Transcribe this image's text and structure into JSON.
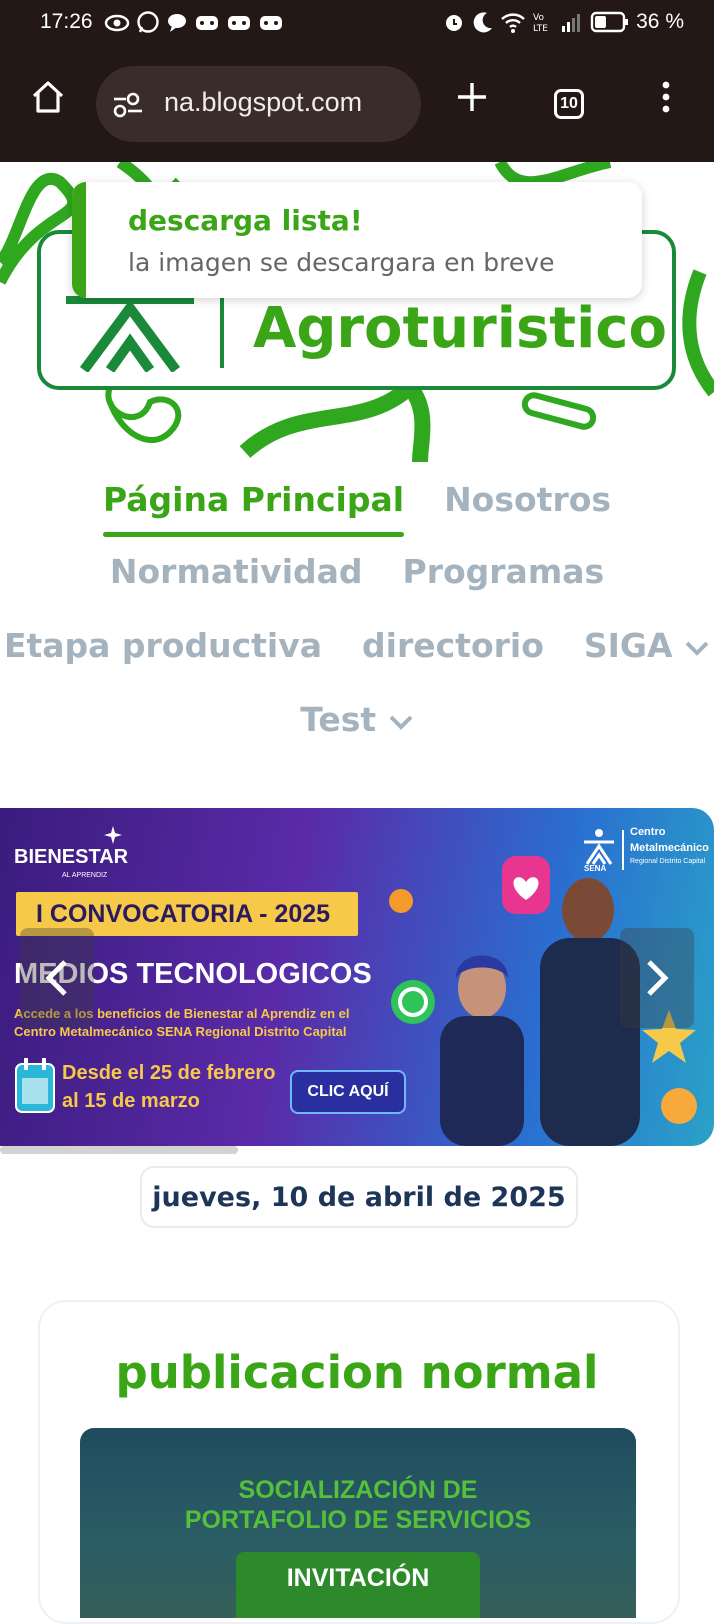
{
  "status_bar": {
    "time": "17:26",
    "battery_percent": "36 %",
    "left_icons": [
      "eye-icon",
      "whatsapp-icon",
      "chat-icon",
      "game-icon",
      "game-icon",
      "game-icon"
    ],
    "right_icons": [
      "alarm-icon",
      "moon-icon",
      "wifi-icon",
      "volte-icon",
      "signal-icon",
      "battery-icon"
    ]
  },
  "browser": {
    "url": "na.blogspot.com",
    "tab_count": "10",
    "buttons": [
      "home-icon",
      "site-settings-icon",
      "new-tab-icon",
      "tabs-icon",
      "menu-icon"
    ]
  },
  "site": {
    "logo_text": "Agroturistico",
    "colors": {
      "brand_green": "#3aa517",
      "dark_green": "#1a8a3a",
      "nav_inactive": "#a5b3bf",
      "date_text": "#1d3557"
    }
  },
  "toast": {
    "title": "descarga lista!",
    "message": "la imagen se descargara en breve"
  },
  "nav": {
    "items": [
      {
        "label": "Página Principal",
        "active": true
      },
      {
        "label": "Nosotros"
      },
      {
        "label": "Normatividad"
      },
      {
        "label": "Programas"
      },
      {
        "label": "Etapa productiva"
      },
      {
        "label": "directorio"
      },
      {
        "label": "SIGA",
        "has_dropdown": true
      },
      {
        "label": "Test",
        "has_dropdown": true
      }
    ]
  },
  "banner": {
    "brand": "BIENESTAR",
    "brand_sub": "AL APRENDIZ",
    "org_line1": "Centro",
    "org_line2": "Metalmecánico",
    "org_line3": "Regional Distrito Capital",
    "org_logo_text": "SENA",
    "tag": "I CONVOCATORIA - 2025",
    "heading": "MEDIOS TECNOLOGICOS",
    "body_line1": "Accede a los beneficios de Bienestar al Aprendiz en el",
    "body_line2": "Centro Metalmecánico SENA Regional Distrito Capital",
    "date_line1": "Desde el 25 de febrero",
    "date_line2": "al 15 de marzo",
    "cta": "CLIC AQUÍ"
  },
  "date": "jueves, 10 de abril de 2025",
  "post": {
    "title": "publicacion normal",
    "image_line1": "SOCIALIZACIÓN DE",
    "image_line2": "PORTAFOLIO DE SERVICIOS",
    "image_badge": "INVITACIÓN"
  }
}
